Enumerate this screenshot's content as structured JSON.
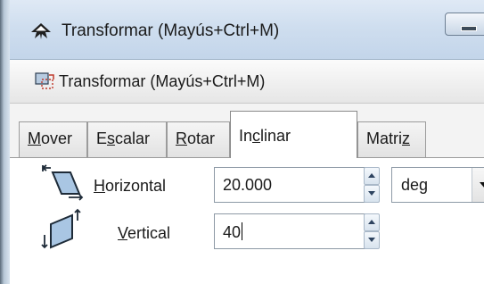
{
  "window": {
    "title": "Transformar (Mayús+Ctrl+M)",
    "min_icon": "minimize-icon"
  },
  "dialog": {
    "title": "Transformar (Mayús+Ctrl+M)",
    "icon": "transform-dialog-icon"
  },
  "tabs": [
    {
      "label_pre": "",
      "label_u": "M",
      "label_post": "over",
      "active": false
    },
    {
      "label_pre": "E",
      "label_u": "s",
      "label_post": "calar",
      "active": false
    },
    {
      "label_pre": "",
      "label_u": "R",
      "label_post": "otar",
      "active": false
    },
    {
      "label_pre": "In",
      "label_u": "c",
      "label_post": "linar",
      "active": true
    },
    {
      "label_pre": "Matri",
      "label_u": "z",
      "label_post": "",
      "active": false
    }
  ],
  "skew": {
    "horizontal": {
      "label_u": "H",
      "label_post": "orizontal",
      "value": "20.000",
      "unit": "deg",
      "icon": "skew-horizontal-icon"
    },
    "vertical": {
      "label_u": "V",
      "label_post": "ertical",
      "value": "40",
      "icon": "skew-vertical-icon"
    }
  },
  "colors": {
    "titlebar": "#cfdeef",
    "active_tab": "#ffffff",
    "panel": "#ffffff",
    "icon_fill": "#a9c6e3",
    "icon_stroke": "#1e2b38"
  }
}
